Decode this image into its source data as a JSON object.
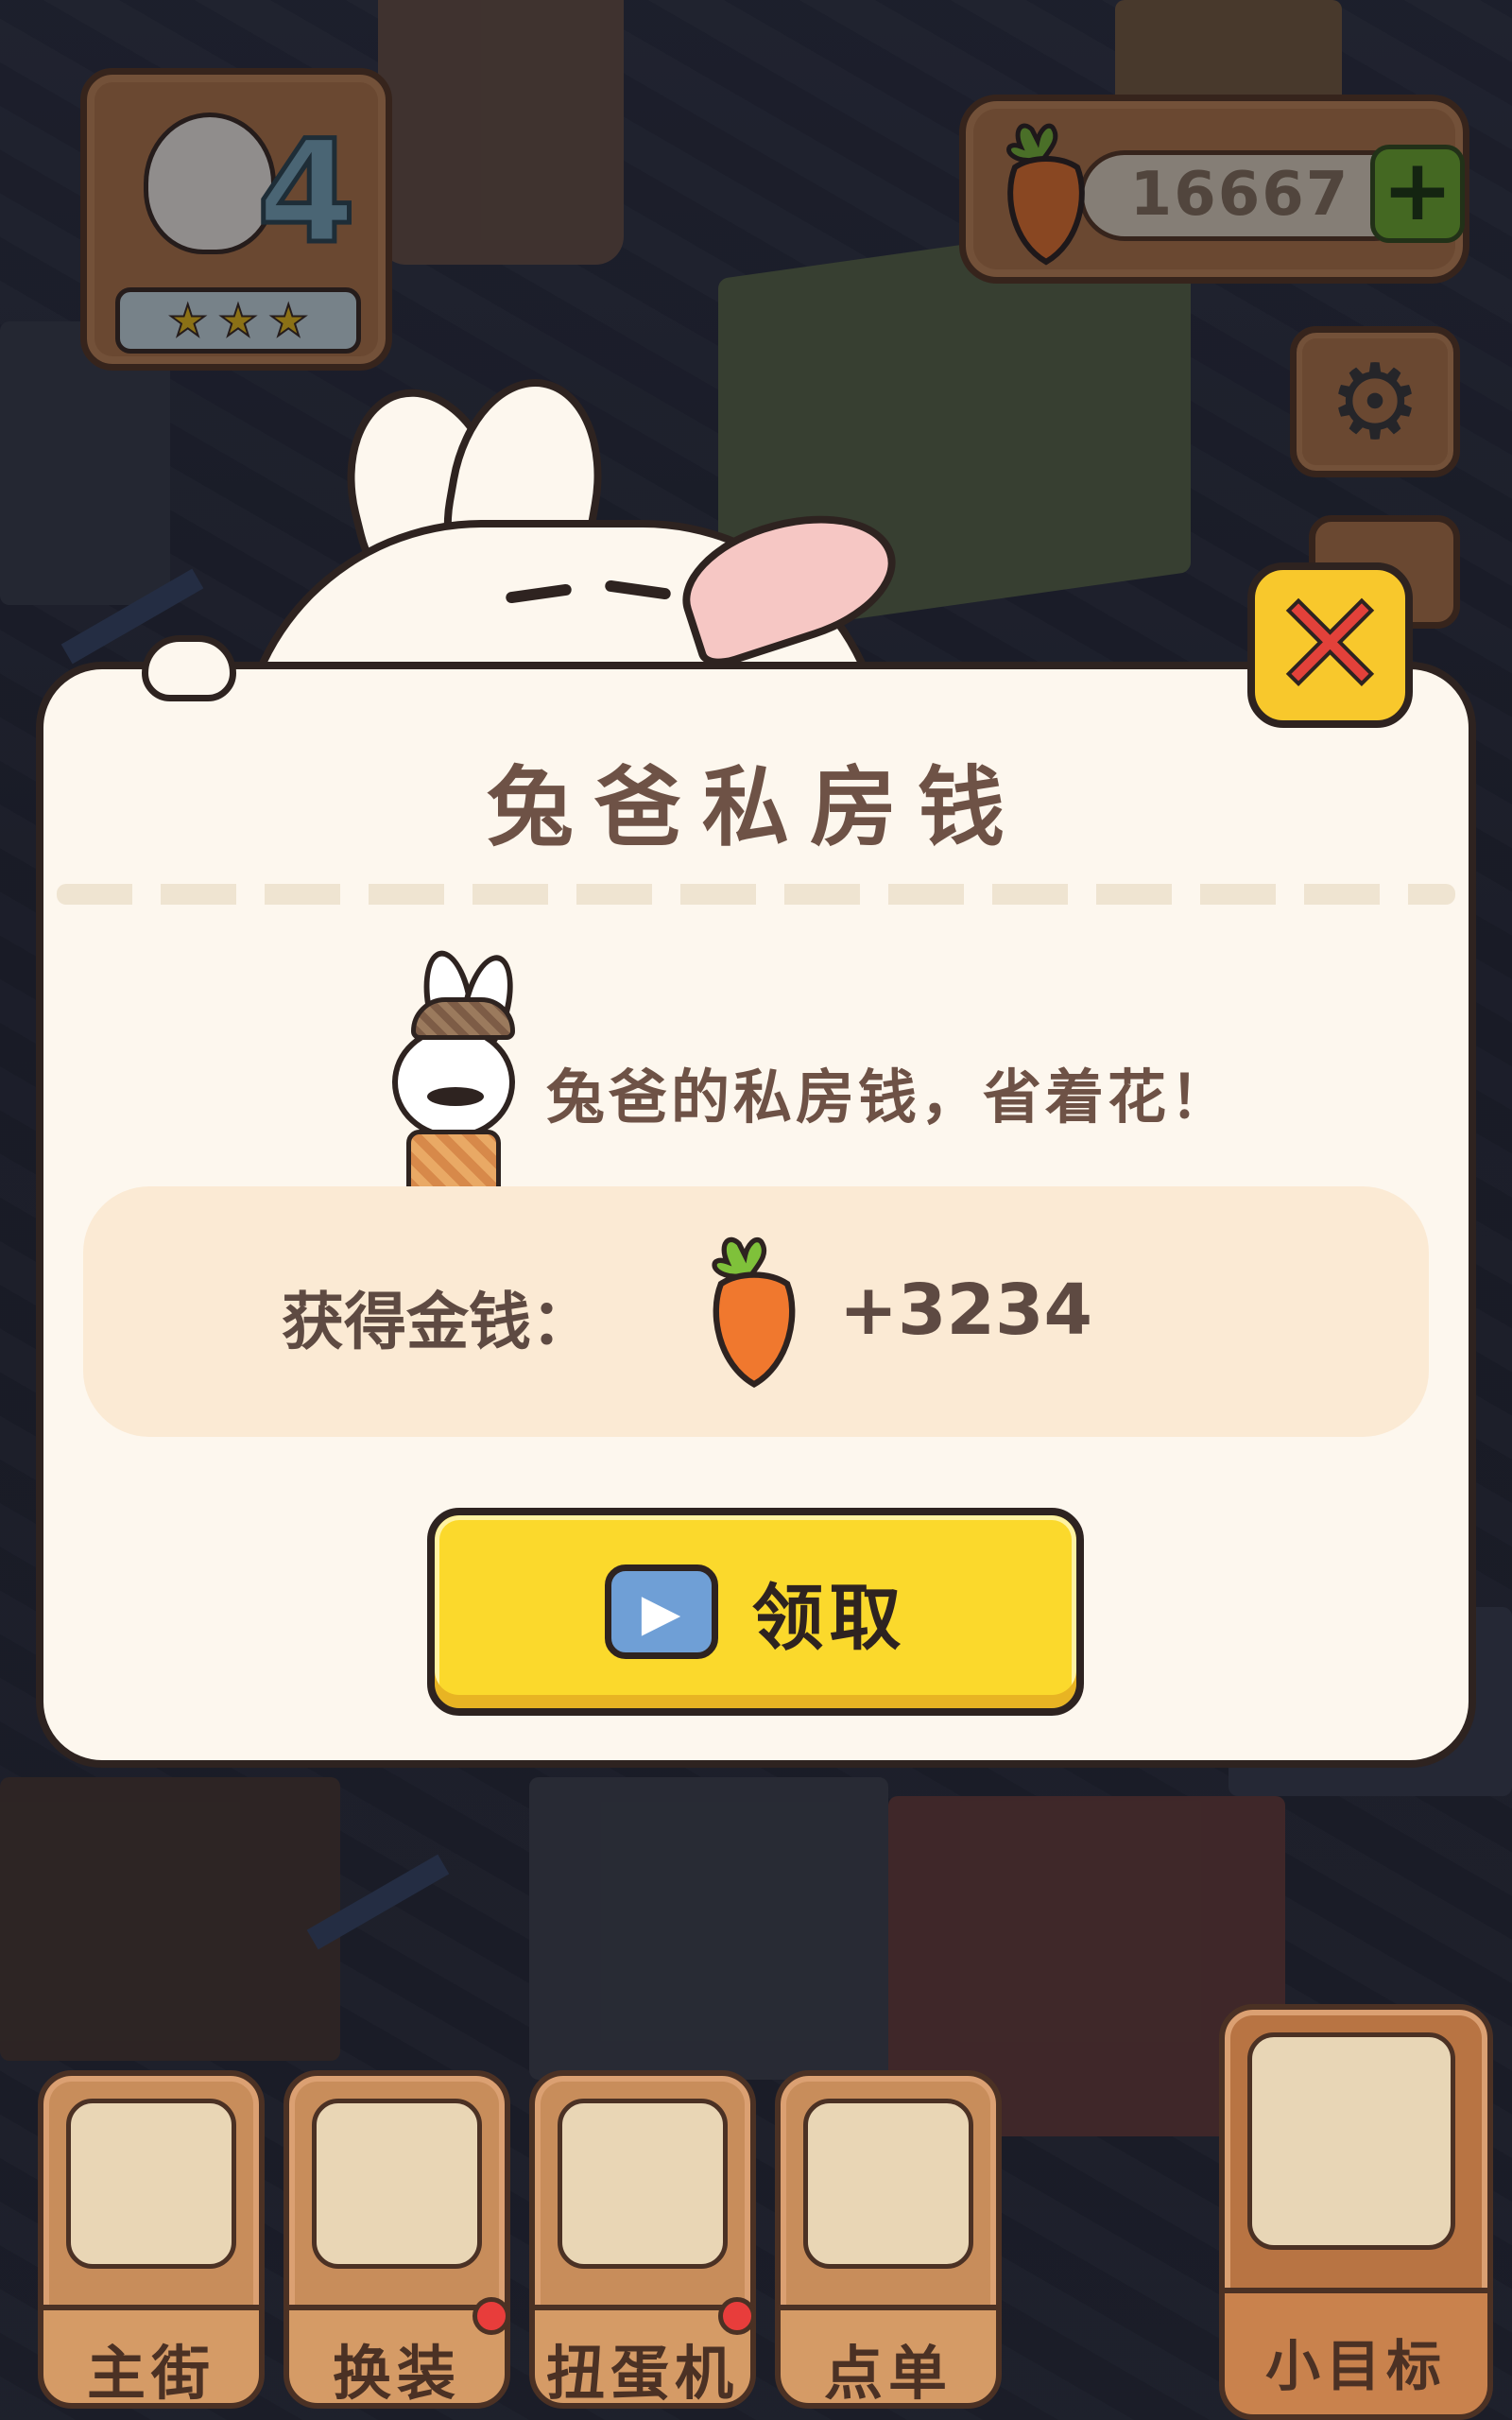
{
  "hud": {
    "level_number": "4",
    "level_stars": 3,
    "currency_amount": "16667",
    "add_currency_label": "+",
    "settings_icon": "gear-icon"
  },
  "dialog": {
    "title": "兔爸私房钱",
    "message": "兔爸的私房钱，省着花！",
    "reward_label": "获得金钱：",
    "reward_amount": "+3234",
    "reward_icon": "carrot-icon",
    "claim_button_label": "领取",
    "claim_button_icon": "video-play-icon",
    "close_icon": "close-x-icon"
  },
  "bottom_nav": {
    "items": [
      {
        "label": "主街",
        "badge": false
      },
      {
        "label": "换装",
        "badge": true
      },
      {
        "label": "扭蛋机",
        "badge": true
      },
      {
        "label": "点单",
        "badge": false
      },
      {
        "label": "小目标",
        "badge": false
      }
    ]
  },
  "colors": {
    "accent_yellow": "#fbd92c",
    "close_red": "#e2413a",
    "carrot_orange": "#f0782e",
    "text_brown": "#6e5246",
    "panel_cream": "#fdf7ee",
    "badge_red": "#e83d3b"
  }
}
